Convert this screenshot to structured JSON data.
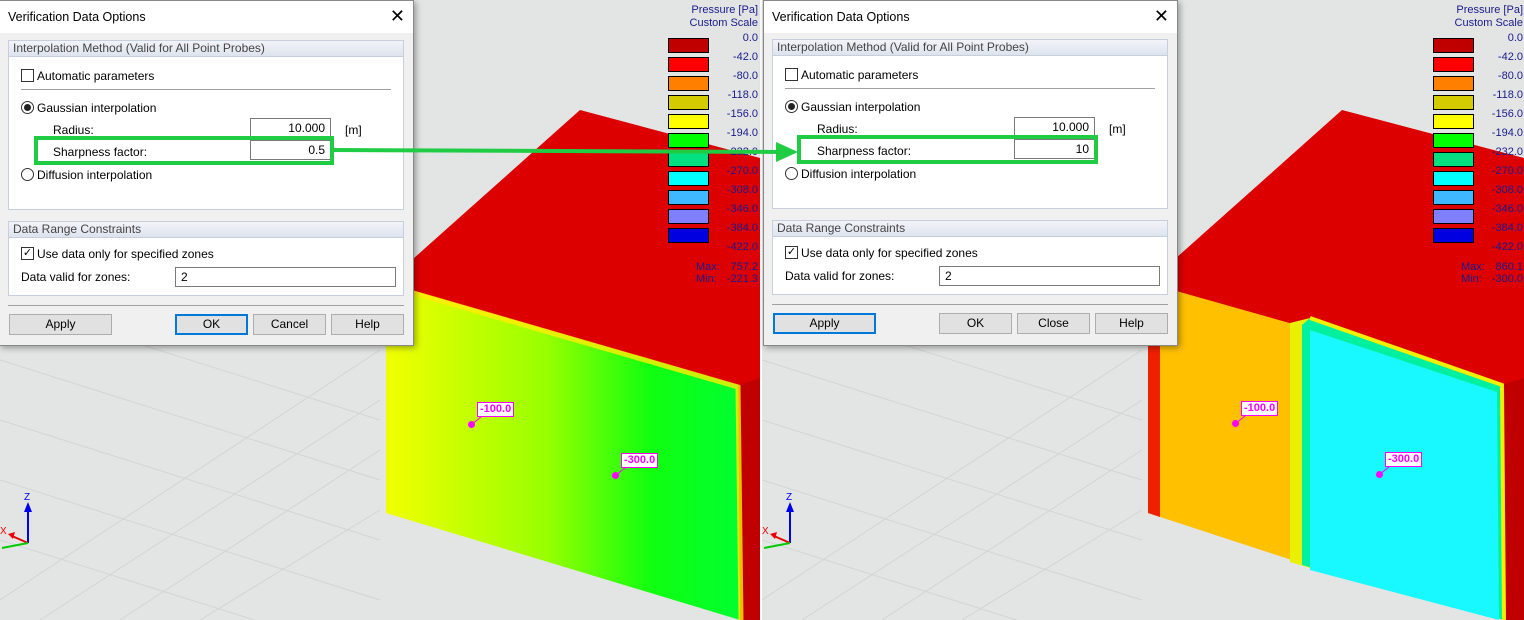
{
  "left": {
    "dialog": {
      "title": "Verification Data Options",
      "interpolation_group": "Interpolation Method (Valid for All Point Probes)",
      "automatic_parameters": {
        "label": "Automatic parameters",
        "checked": false
      },
      "gaussian": {
        "label": "Gaussian interpolation",
        "selected": true
      },
      "radius_label": "Radius:",
      "radius_value": "10.000",
      "radius_unit": "[m]",
      "sharpness_label": "Sharpness factor:",
      "sharpness_value": "0.5",
      "diffusion": {
        "label": "Diffusion interpolation",
        "selected": false
      },
      "range_group": "Data Range Constraints",
      "use_zones": {
        "label": "Use data only for specified zones",
        "checked": true
      },
      "zones_label": "Data valid for zones:",
      "zones_value": "2",
      "buttons": {
        "apply": "Apply",
        "ok": "OK",
        "cancel": "Cancel",
        "help": "Help"
      },
      "default_button": "ok"
    },
    "legend": {
      "title": "Pressure [Pa]",
      "subtitle": "Custom Scale",
      "levels": [
        "0.0",
        "-42.0",
        "-80.0",
        "-118.0",
        "-156.0",
        "-194.0",
        "-232.0",
        "-270.0",
        "-308.0",
        "-346.0",
        "-384.0",
        "-422.0"
      ],
      "max_label": "Max:",
      "max_value": "757.2",
      "min_label": "Min:",
      "min_value": "-221.3"
    },
    "probes": [
      "-100.0",
      "-300.0"
    ],
    "axes": {
      "z": "Z",
      "x": "X"
    }
  },
  "right": {
    "dialog": {
      "title": "Verification Data Options",
      "interpolation_group": "Interpolation Method (Valid for All Point Probes)",
      "automatic_parameters": {
        "label": "Automatic parameters",
        "checked": false
      },
      "gaussian": {
        "label": "Gaussian interpolation",
        "selected": true
      },
      "radius_label": "Radius:",
      "radius_value": "10.000",
      "radius_unit": "[m]",
      "sharpness_label": "Sharpness factor:",
      "sharpness_value": "10",
      "diffusion": {
        "label": "Diffusion interpolation",
        "selected": false
      },
      "range_group": "Data Range Constraints",
      "use_zones": {
        "label": "Use data only for specified zones",
        "checked": true
      },
      "zones_label": "Data valid for zones:",
      "zones_value": "2",
      "buttons": {
        "apply": "Apply",
        "ok": "OK",
        "close": "Close",
        "help": "Help"
      },
      "default_button": "apply"
    },
    "legend": {
      "title": "Pressure [Pa]",
      "subtitle": "Custom Scale",
      "levels": [
        "0.0",
        "-42.0",
        "-80.0",
        "-118.0",
        "-156.0",
        "-194.0",
        "-232.0",
        "-270.0",
        "-308.0",
        "-346.0",
        "-384.0",
        "-422.0"
      ],
      "max_label": "Max:",
      "max_value": "860.1",
      "min_label": "Min:",
      "min_value": "-300.0"
    },
    "probes": [
      "-100.0",
      "-300.0"
    ],
    "axes": {
      "z": "Z",
      "x": "X"
    }
  },
  "legend_colors": [
    "#c00000",
    "#ff0000",
    "#ff8000",
    "#d4cc00",
    "#ffff00",
    "#00ff00",
    "#00e080",
    "#00ffff",
    "#40b8ff",
    "#8080ff",
    "#0000e0"
  ],
  "highlight_color": "#1fcc44"
}
